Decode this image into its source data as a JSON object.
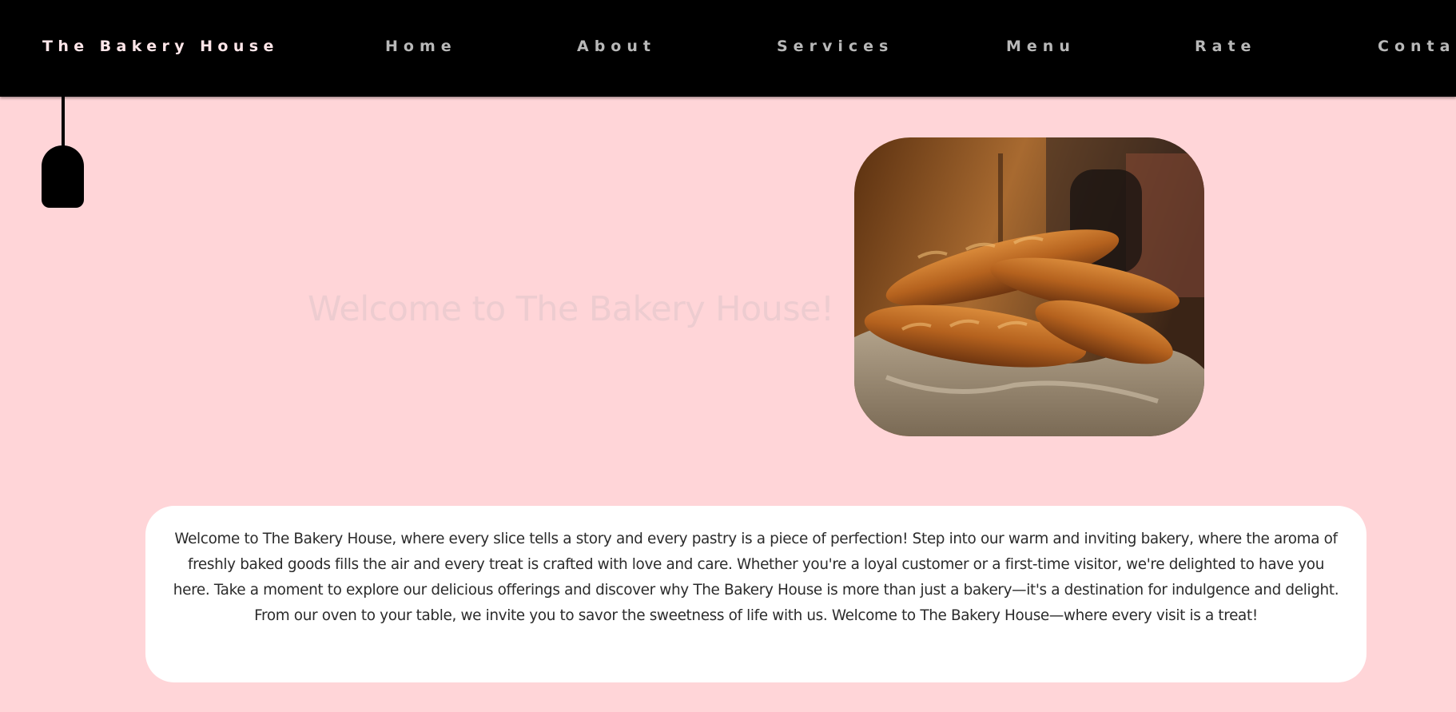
{
  "nav": {
    "brand": "The Bakery House",
    "links": [
      "Home",
      "About",
      "Services",
      "Menu",
      "Rate",
      "Contact"
    ]
  },
  "hero": {
    "title": "Welcome to The Bakery House!",
    "image": "baguettes-photo"
  },
  "welcome": {
    "text": "Welcome to The Bakery House, where every slice tells a story and every pastry is a piece of perfection! Step into our warm and inviting bakery, where the aroma of freshly baked goods fills the air and every treat is crafted with love and care. Whether you're a loyal customer or a first-time visitor, we're delighted to have you here. Take a moment to explore our delicious offerings and discover why The Bakery House is more than just a bakery—it's a destination for indulgence and delight. From our oven to your table, we invite you to savor the sweetness of life with us. Welcome to The Bakery House—where every visit is a treat!"
  },
  "colors": {
    "background": "#ffd5d8",
    "navbar": "#000000",
    "brand_text": "#ffe6e9",
    "nav_text": "#b8b8b8",
    "hero_title": "#edccd0",
    "card": "#ffffff"
  }
}
